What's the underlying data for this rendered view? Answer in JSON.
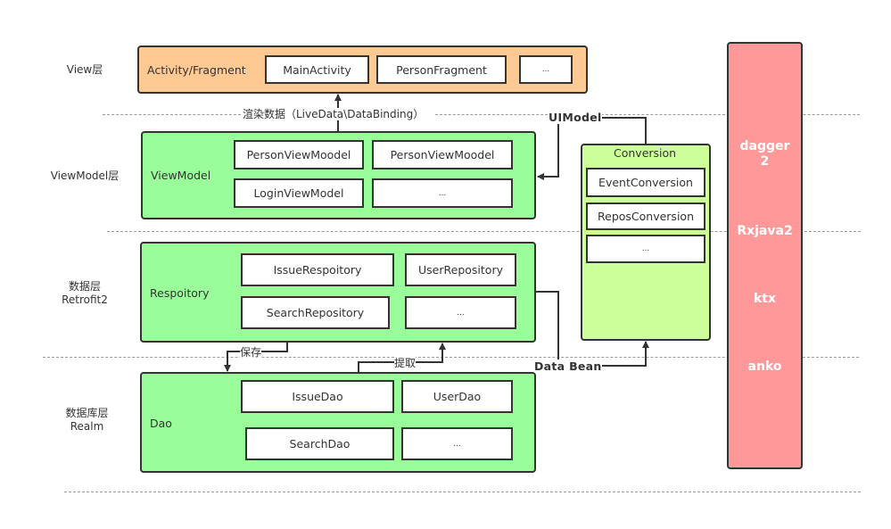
{
  "layers": [
    {
      "label": "View层"
    },
    {
      "label": "ViewModel层"
    },
    {
      "label": "数据层\nRetrofit2",
      "line1": "数据层",
      "line2": "Retrofit2"
    },
    {
      "label": "数据库层\nRealm",
      "line1": "数据库层",
      "line2": "Realm"
    }
  ],
  "view_group": {
    "title": "Activity/Fragment",
    "items": [
      "MainActivity",
      "PersonFragment",
      "..."
    ]
  },
  "viewmodel_group": {
    "title": "ViewModel",
    "items": [
      "PersonViewMoodel",
      "PersonViewMoodel",
      "LoginViewModel",
      "..."
    ]
  },
  "repository_group": {
    "title": "Respoitory",
    "items": [
      "IssueRespoitory",
      "UserRepository",
      "SearchRepository",
      "..."
    ]
  },
  "dao_group": {
    "title": "Dao",
    "items": [
      "IssueDao",
      "UserDao",
      "SearchDao",
      "..."
    ]
  },
  "conversion_group": {
    "title": "Conversion",
    "items": [
      "EventConversion",
      "ReposConversion",
      "..."
    ]
  },
  "libraries": {
    "items": [
      "dagger\n2",
      "Rxjava2",
      "ktx",
      "anko"
    ],
    "dagger_line1": "dagger",
    "dagger_line2": "2"
  },
  "edges": {
    "render_label": "渲染数据（LiveData\\DataBinding）",
    "uimodel_label": "UIModel",
    "save_label": "保存",
    "fetch_label": "提取",
    "databean_label": "Data Bean"
  },
  "colors": {
    "view_fill": "#ffc993",
    "green_fill": "#99fe99",
    "conversion_fill": "#ccff99",
    "library_fill": "#ff9999",
    "stroke": "#333333"
  }
}
